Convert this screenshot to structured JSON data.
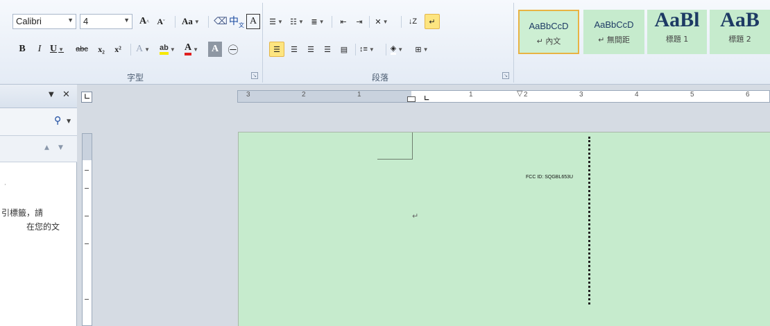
{
  "font": {
    "name": "Calibri",
    "size": "4",
    "grow_glyph": "A",
    "shrink_glyph": "A",
    "change_case": "Aa",
    "phonetic": "㊫",
    "char_border": "A",
    "bold": "B",
    "italic": "I",
    "underline": "U",
    "strike": "abc",
    "subscript": "x₂",
    "superscript": "x²",
    "text_effect": "A",
    "highlight": "ab",
    "font_color": "A",
    "char_shading": "A",
    "enclose": "㊀",
    "group_label": "字型"
  },
  "paragraph": {
    "group_label": "段落"
  },
  "styles": [
    {
      "sample": "AaBbCcD",
      "name": "↵ 內文"
    },
    {
      "sample": "AaBbCcD",
      "name": "↵ 無間距"
    },
    {
      "sample": "AaBl",
      "name": "標題 1"
    },
    {
      "sample": "AaB",
      "name": "標題 2"
    }
  ],
  "nav": {
    "close": "✕",
    "text_line1": "引標籤，請",
    "text_line2": "在您的文"
  },
  "ruler": {
    "numbers": [
      "3",
      "2",
      "1",
      "1",
      "2",
      "3",
      "4",
      "5",
      "6"
    ]
  },
  "document": {
    "fcc_text": "FCC ID: SQGBL653U",
    "para_mark": "↵"
  },
  "colors": {
    "page_bg": "#c6ebcd",
    "highlight_yellow": "#f7e800",
    "font_color_red": "#e02020"
  }
}
